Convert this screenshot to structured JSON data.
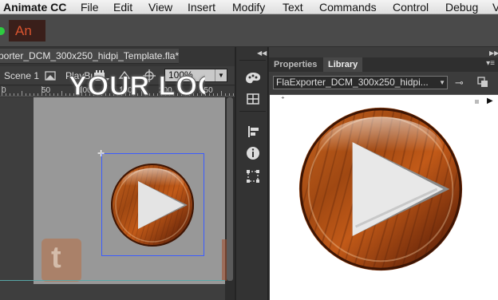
{
  "menubar": {
    "app_name": "Animate CC",
    "items": [
      "File",
      "Edit",
      "View",
      "Insert",
      "Modify",
      "Text",
      "Commands",
      "Control",
      "Debug",
      "V"
    ]
  },
  "appbar": {
    "logo": "An"
  },
  "document": {
    "tab_title": "porter_DCM_300x250_hidpi_Template.fla*",
    "scene_label": "Scene 1",
    "symbol_label": "PlayBu",
    "zoom_value": "100%"
  },
  "ruler": {
    "labels": [
      "0",
      "50",
      "100",
      "150",
      "200",
      "250"
    ]
  },
  "stage": {
    "logo_text": "YOUR LOGO",
    "twitter_glyph": "t"
  },
  "panels": {
    "tabs": [
      "Properties",
      "Library"
    ],
    "active_tab": "Library",
    "library_select": "FlaExporter_DCM_300x250_hidpi..."
  },
  "icons": {
    "mid_tools": [
      "palette-icon",
      "grid-icon",
      "align-icon",
      "info-icon",
      "transform-icon"
    ]
  },
  "colors": {
    "wood_light": "#d2691e",
    "wood_dark": "#6b2a0c",
    "selection_blue": "#3b5cff",
    "accent_green": "#2ecc40"
  }
}
